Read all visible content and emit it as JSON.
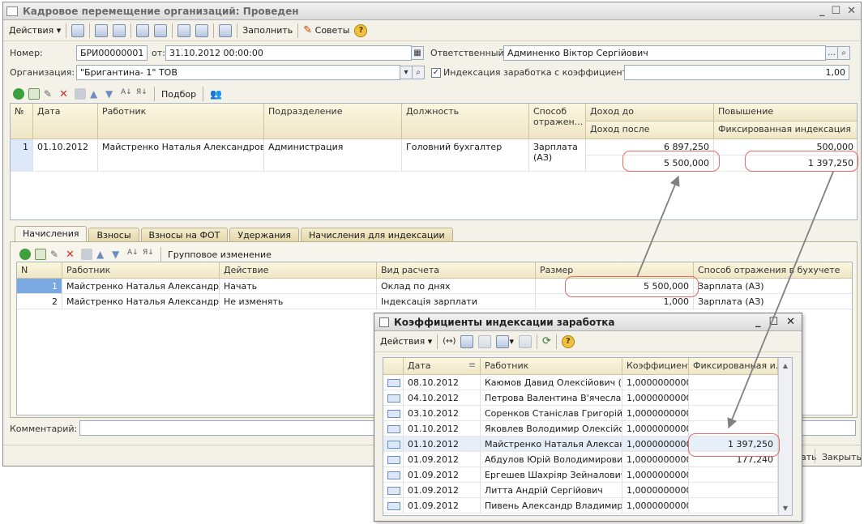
{
  "window": {
    "title": "Кадровое перемещение организаций: Проведен"
  },
  "toolbar": {
    "actions": "Действия",
    "fill": "Заполнить",
    "advice": "Советы"
  },
  "form": {
    "number_label": "Номер:",
    "number": "БРИ00000001",
    "from_label": "от:",
    "date": "31.10.2012 00:00:00",
    "responsible_label": "Ответственный:",
    "responsible": "Админенко Віктор Сергійович",
    "org_label": "Организация:",
    "org": "\"Бригантина- 1\" ТОВ",
    "indexation_label": "Индексация заработка с коэффициентом:",
    "indexation_value": "1,00",
    "comment_label": "Комментарий:"
  },
  "grid_toolbar": {
    "pick": "Подбор"
  },
  "main_table": {
    "headers": {
      "n": "№",
      "date": "Дата",
      "worker": "Работник",
      "dept": "Подразделение",
      "position": "Должность",
      "method": "Способ отражен...",
      "income_before": "Доход до",
      "income_after": "Доход после",
      "raise": "Повышение",
      "fixed_index": "Фиксированная индексация"
    },
    "rows": [
      {
        "n": "1",
        "date": "01.10.2012",
        "worker": "Майстренко Наталья Александровна",
        "dept": "Администрация",
        "position": "Головний бухгалтер",
        "method": "Зарплата (АЗ)",
        "income_before": "6 897,250",
        "income_after": "5 500,000",
        "raise": "500,000",
        "fixed_index": "1 397,250"
      }
    ]
  },
  "tabs": [
    "Начисления",
    "Взносы",
    "Взносы на ФОТ",
    "Удержания",
    "Начисления для индексации"
  ],
  "accruals_toolbar": {
    "group_change": "Групповое изменение"
  },
  "accruals": {
    "headers": {
      "n": "N",
      "worker": "Работник",
      "action": "Действие",
      "calc_type": "Вид расчета",
      "size": "Размер",
      "method": "Способ отражения в бухучете"
    },
    "rows": [
      {
        "n": "1",
        "worker": "Майстренко Наталья Александро...",
        "action": "Начать",
        "calc_type": "Оклад по днях",
        "size": "5 500,000",
        "method": "Зарплата (АЗ)"
      },
      {
        "n": "2",
        "worker": "Майстренко Наталья Александро...",
        "action": "Не изменять",
        "calc_type": "Індексація зарплати",
        "size": "1,000",
        "method": "Зарплата (АЗ)"
      }
    ]
  },
  "footer": {
    "close": "Закрыть",
    "partial": "ать"
  },
  "sub": {
    "title": "Коэффициенты индексации заработка",
    "actions": "Действия",
    "headers": {
      "date": "Дата",
      "worker": "Работник",
      "coef": "Коэффициент",
      "fixed": "Фиксированная и..."
    },
    "rows": [
      {
        "date": "08.10.2012",
        "worker": "Каюмов Давид Олексійович (о...",
        "coef": "1,0000000000",
        "fixed": ""
      },
      {
        "date": "04.10.2012",
        "worker": "Петрова Валентина В'ячеслав...",
        "coef": "1,0000000000",
        "fixed": ""
      },
      {
        "date": "03.10.2012",
        "worker": "Соренков Станіслав Григорійо...",
        "coef": "1,0000000000",
        "fixed": ""
      },
      {
        "date": "01.10.2012",
        "worker": "Яковлев Володимир Олексійо...",
        "coef": "1,0000000000",
        "fixed": ""
      },
      {
        "date": "01.10.2012",
        "worker": "Майстренко Наталья Алексан...",
        "coef": "1,0000000000",
        "fixed": "1 397,250"
      },
      {
        "date": "01.09.2012",
        "worker": "Абдулов Юрій Володимирович (...",
        "coef": "1,0000000000",
        "fixed": "177,240"
      },
      {
        "date": "01.09.2012",
        "worker": "Ергешев Шахріяр Зейналович",
        "coef": "1,0000000000",
        "fixed": ""
      },
      {
        "date": "01.09.2012",
        "worker": "Литта Андрій Сергійович",
        "coef": "1,0000000000",
        "fixed": ""
      },
      {
        "date": "01.09.2012",
        "worker": "Пивень Александр Владимиро...",
        "coef": "1,0000000000",
        "fixed": ""
      }
    ]
  },
  "colors": {
    "highlight": "#e86a6a",
    "arrow": "#808080",
    "header_bg": "#f3ecd2"
  }
}
